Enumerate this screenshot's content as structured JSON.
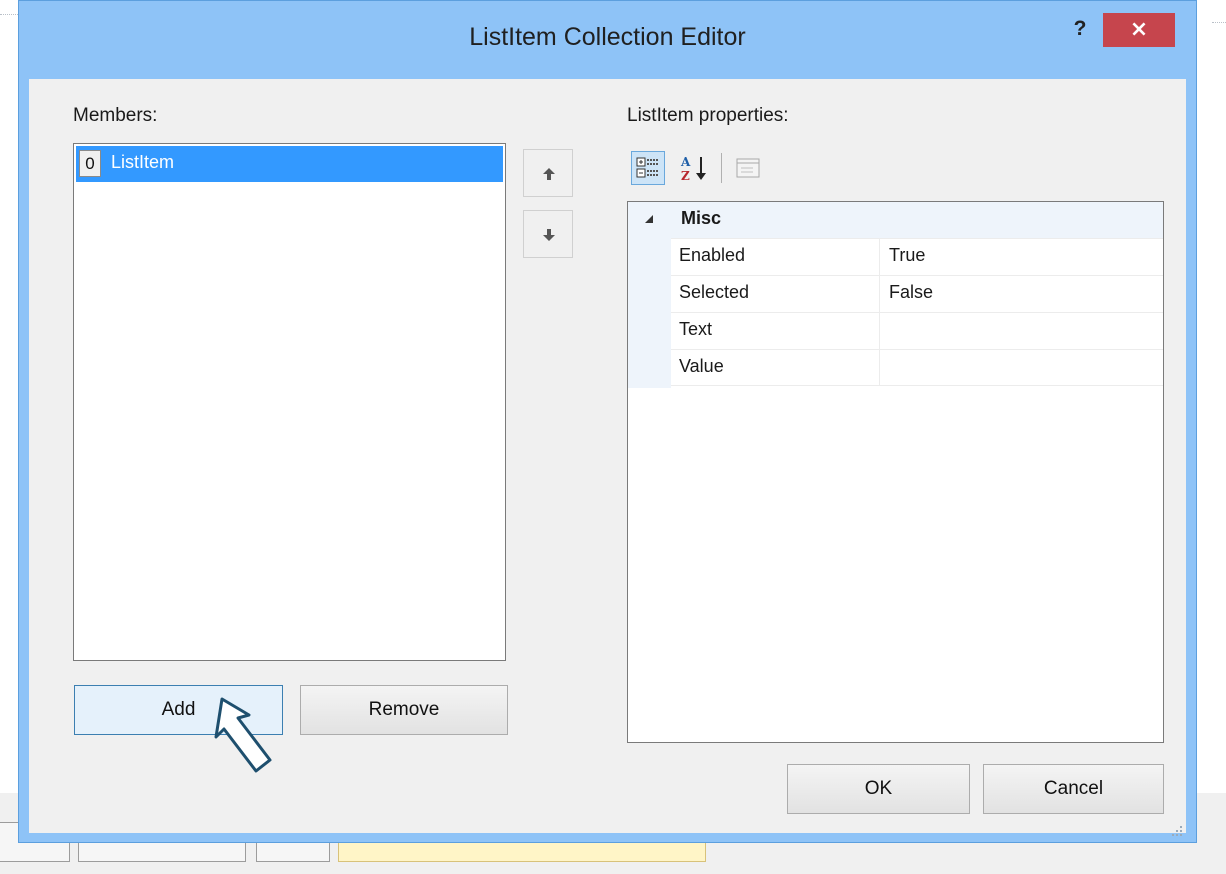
{
  "window": {
    "title": "ListItem Collection Editor",
    "help_label": "?",
    "close_label": "×"
  },
  "members": {
    "label": "Members:",
    "items": [
      {
        "index": "0",
        "label": "ListItem",
        "selected": true
      }
    ]
  },
  "reorder": {
    "up_icon": "arrow-up-icon",
    "down_icon": "arrow-down-icon"
  },
  "properties": {
    "label": "ListItem properties:",
    "toolbar": [
      "categorized-icon",
      "alphabetical-icon",
      "property-pages-icon"
    ],
    "category": "Misc",
    "rows": [
      {
        "name": "Enabled",
        "value": "True"
      },
      {
        "name": "Selected",
        "value": "False"
      },
      {
        "name": "Text",
        "value": ""
      },
      {
        "name": "Value",
        "value": ""
      }
    ]
  },
  "buttons": {
    "add": "Add",
    "remove": "Remove",
    "ok": "OK",
    "cancel": "Cancel"
  },
  "colors": {
    "title_bar": "#8ec3f7",
    "close": "#c6454d",
    "selection": "#3399ff"
  }
}
